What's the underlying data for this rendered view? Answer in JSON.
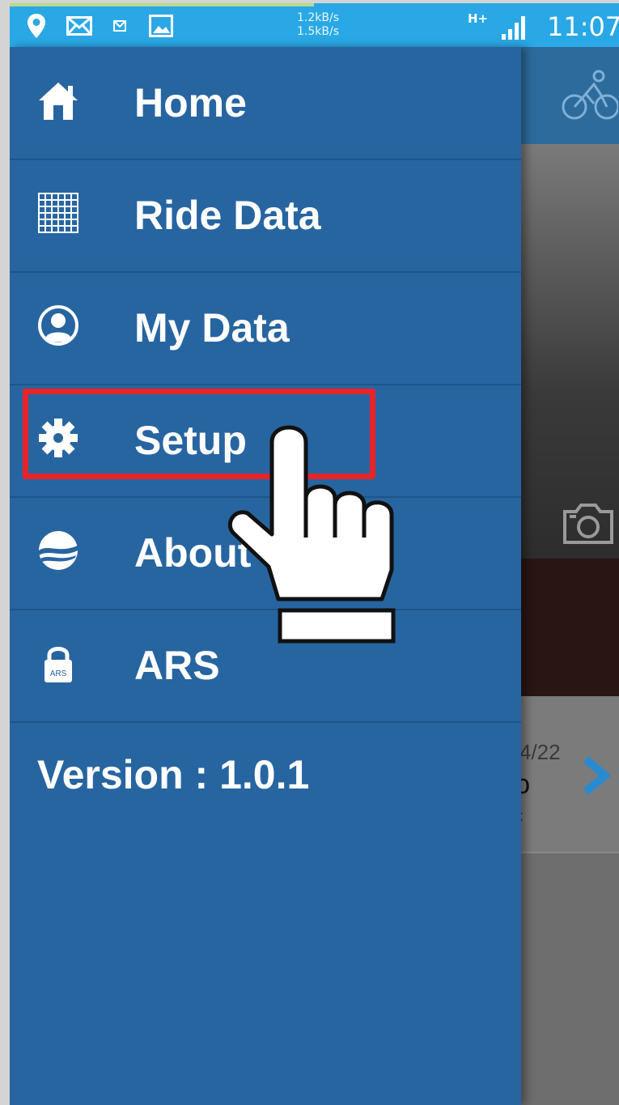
{
  "status_bar": {
    "net_speed_up": "1.2kB/s",
    "net_speed_down": "1.5kB/s",
    "network_type": "H+",
    "time": "11:07",
    "icons": [
      "location-icon",
      "mail-icon",
      "message-icon",
      "image-icon",
      "signal-icon"
    ]
  },
  "drawer": {
    "items": [
      {
        "label": "Home",
        "icon": "home-icon"
      },
      {
        "label": "Ride Data",
        "icon": "grid-icon"
      },
      {
        "label": "My Data",
        "icon": "user-icon"
      },
      {
        "label": "Setup",
        "icon": "gear-icon"
      },
      {
        "label": "About",
        "icon": "logo-icon"
      },
      {
        "label": "ARS",
        "icon": "lock-icon",
        "icon_text": "ARS"
      }
    ],
    "version": "Version : 1.0.1",
    "highlighted_item": "Setup"
  },
  "background": {
    "header_icon": "cyclist-icon",
    "camera_icon": "camera-icon",
    "date_fragment": "4/22",
    "next_icon": "chevron-right-icon"
  },
  "colors": {
    "status_bar": "#2aa8e6",
    "drawer": "#2765a1",
    "highlight": "#e8232a",
    "accent_chevron": "#2a8ad0"
  }
}
